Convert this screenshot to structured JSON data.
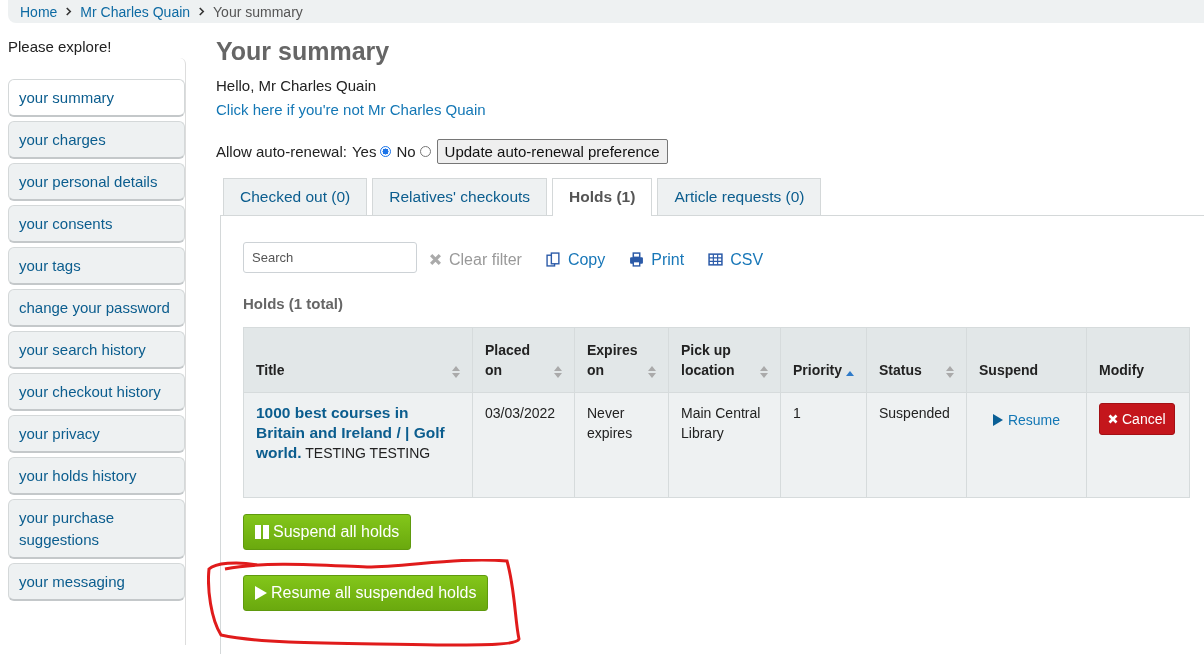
{
  "breadcrumb": [
    {
      "label": "Home",
      "kind": "link"
    },
    {
      "label": "Mr Charles Quain",
      "kind": "link"
    },
    {
      "label": "Your summary",
      "kind": "current"
    }
  ],
  "sidebar": {
    "heading": "Please explore!",
    "items": [
      {
        "label": "your summary",
        "selected": true
      },
      {
        "label": "your charges",
        "selected": false
      },
      {
        "label": "your personal details",
        "selected": false
      },
      {
        "label": "your consents",
        "selected": false
      },
      {
        "label": "your tags",
        "selected": false
      },
      {
        "label": "change your password",
        "selected": false
      },
      {
        "label": "your search history",
        "selected": false
      },
      {
        "label": "your checkout history",
        "selected": false
      },
      {
        "label": "your privacy",
        "selected": false
      },
      {
        "label": "your holds history",
        "selected": false
      },
      {
        "label": "your purchase suggestions",
        "selected": false
      },
      {
        "label": "your messaging",
        "selected": false
      }
    ]
  },
  "page_title": "Your summary",
  "greeting": "Hello, Mr Charles Quain",
  "not_you_link": "Click here if you're not Mr Charles Quain",
  "auto_renewal": {
    "label": "Allow auto-renewal:",
    "options": [
      {
        "label": "Yes",
        "selected": true
      },
      {
        "label": "No",
        "selected": false
      }
    ],
    "button": "Update auto-renewal preference"
  },
  "tabs": [
    {
      "label": "Checked out (0)",
      "selected": false
    },
    {
      "label": "Relatives' checkouts",
      "selected": false
    },
    {
      "label": "Holds (1)",
      "selected": true
    },
    {
      "label": "Article requests (0)",
      "selected": false
    }
  ],
  "toolbar": {
    "search_placeholder": "Search",
    "clear_filter": "Clear filter",
    "copy": "Copy",
    "print": "Print",
    "csv": "CSV"
  },
  "holds_heading": "Holds (1 total)",
  "table": {
    "columns": [
      {
        "label": "Title",
        "kind": "sortable"
      },
      {
        "label": "Placed on",
        "kind": "sortable"
      },
      {
        "label": "Expires on",
        "kind": "sortable"
      },
      {
        "label": "Pick up location",
        "kind": "sortable"
      },
      {
        "label": "Priority",
        "kind": "ascending"
      },
      {
        "label": "Status",
        "kind": "sortable"
      },
      {
        "label": "Suspend",
        "kind": "plain"
      },
      {
        "label": "Modify",
        "kind": "plain"
      }
    ],
    "rows": [
      {
        "title": "**1000 best courses in Britain and Ireland / | Golf world.** TESTING TESTING",
        "placed_on": "03/03/2022",
        "expires_on": "Never expires",
        "pickup_location": "Main Central Library",
        "priority": "1",
        "status": "Suspended",
        "suspend_action": "Resume",
        "modify_action": "Cancel"
      }
    ]
  },
  "suspend_all_button": "Suspend all holds",
  "resume_all_button": "Resume all suspended holds"
}
